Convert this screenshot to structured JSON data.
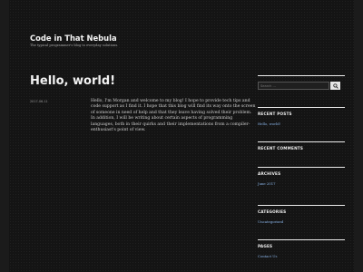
{
  "header": {
    "site_title": "Code in That Nebula",
    "site_description": "The typical programmer's blog to everyday solutions."
  },
  "post": {
    "title": "Hello, world!",
    "date": "2017-06-11",
    "content": "Hello, I'm Morgan and welcome to my blog! I hope to provide tech tips and code support as I find it. I hope that this blog will find its way onto the screen of someone in need of help and that they leave having solved their problem. In addition, I will be writing about certain aspects of programming languages, both in their quirks and their implementations from a compiler-enthusiast's point of view."
  },
  "sidebar": {
    "search": {
      "placeholder": "Search …",
      "button_icon": "search-icon"
    },
    "recent_posts": {
      "title": "RECENT POSTS",
      "items": [
        "Hello, world!"
      ]
    },
    "recent_comments": {
      "title": "RECENT COMMENTS"
    },
    "archives": {
      "title": "ARCHIVES",
      "items": [
        "June 2017"
      ]
    },
    "categories": {
      "title": "CATEGORIES",
      "items": [
        "Uncategorized"
      ]
    },
    "pages": {
      "title": "PAGES",
      "items": [
        "Contact Us"
      ]
    }
  },
  "colors": {
    "background": "#1b1b1b",
    "content_background": "#141414",
    "text": "#e8e8e8",
    "link": "#8ab4e8"
  }
}
